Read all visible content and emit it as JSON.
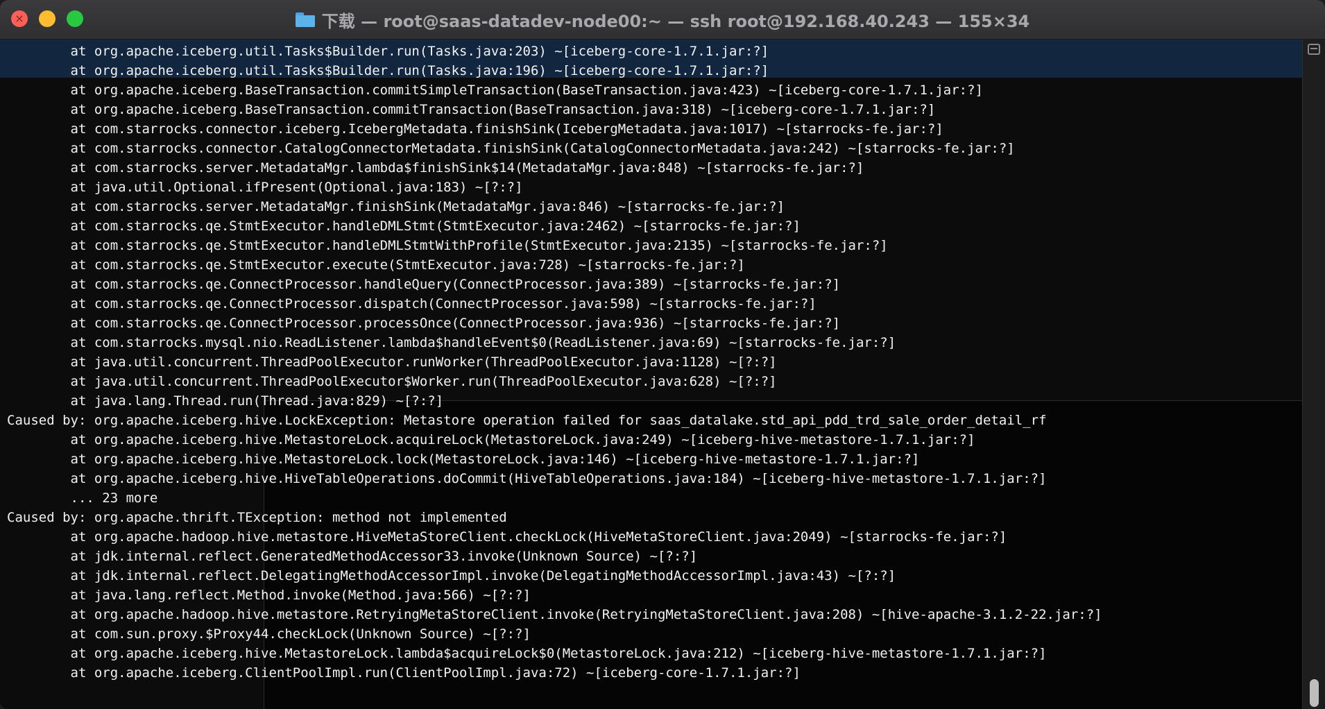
{
  "window": {
    "title": "下载 — root@saas-datadev-node00:~ — ssh root@192.168.40.243 — 155×34",
    "title_icon": "folder-icon"
  },
  "colors": {
    "close": "#fe5f57",
    "minimize": "#febc2e",
    "maximize": "#28c840",
    "terminal_bg": "#0c0c0c",
    "terminal_fg": "#f2f2f2"
  },
  "terminal": {
    "lines": [
      "        at org.apache.iceberg.util.Tasks$Builder.run(Tasks.java:203) ~[iceberg-core-1.7.1.jar:?]",
      "        at org.apache.iceberg.util.Tasks$Builder.run(Tasks.java:196) ~[iceberg-core-1.7.1.jar:?]",
      "        at org.apache.iceberg.BaseTransaction.commitSimpleTransaction(BaseTransaction.java:423) ~[iceberg-core-1.7.1.jar:?]",
      "        at org.apache.iceberg.BaseTransaction.commitTransaction(BaseTransaction.java:318) ~[iceberg-core-1.7.1.jar:?]",
      "        at com.starrocks.connector.iceberg.IcebergMetadata.finishSink(IcebergMetadata.java:1017) ~[starrocks-fe.jar:?]",
      "        at com.starrocks.connector.CatalogConnectorMetadata.finishSink(CatalogConnectorMetadata.java:242) ~[starrocks-fe.jar:?]",
      "        at com.starrocks.server.MetadataMgr.lambda$finishSink$14(MetadataMgr.java:848) ~[starrocks-fe.jar:?]",
      "        at java.util.Optional.ifPresent(Optional.java:183) ~[?:?]",
      "        at com.starrocks.server.MetadataMgr.finishSink(MetadataMgr.java:846) ~[starrocks-fe.jar:?]",
      "        at com.starrocks.qe.StmtExecutor.handleDMLStmt(StmtExecutor.java:2462) ~[starrocks-fe.jar:?]",
      "        at com.starrocks.qe.StmtExecutor.handleDMLStmtWithProfile(StmtExecutor.java:2135) ~[starrocks-fe.jar:?]",
      "        at com.starrocks.qe.StmtExecutor.execute(StmtExecutor.java:728) ~[starrocks-fe.jar:?]",
      "        at com.starrocks.qe.ConnectProcessor.handleQuery(ConnectProcessor.java:389) ~[starrocks-fe.jar:?]",
      "        at com.starrocks.qe.ConnectProcessor.dispatch(ConnectProcessor.java:598) ~[starrocks-fe.jar:?]",
      "        at com.starrocks.qe.ConnectProcessor.processOnce(ConnectProcessor.java:936) ~[starrocks-fe.jar:?]",
      "        at com.starrocks.mysql.nio.ReadListener.lambda$handleEvent$0(ReadListener.java:69) ~[starrocks-fe.jar:?]",
      "        at java.util.concurrent.ThreadPoolExecutor.runWorker(ThreadPoolExecutor.java:1128) ~[?:?]",
      "        at java.util.concurrent.ThreadPoolExecutor$Worker.run(ThreadPoolExecutor.java:628) ~[?:?]",
      "        at java.lang.Thread.run(Thread.java:829) ~[?:?]",
      "Caused by: org.apache.iceberg.hive.LockException: Metastore operation failed for saas_datalake.std_api_pdd_trd_sale_order_detail_rf",
      "        at org.apache.iceberg.hive.MetastoreLock.acquireLock(MetastoreLock.java:249) ~[iceberg-hive-metastore-1.7.1.jar:?]",
      "        at org.apache.iceberg.hive.MetastoreLock.lock(MetastoreLock.java:146) ~[iceberg-hive-metastore-1.7.1.jar:?]",
      "        at org.apache.iceberg.hive.HiveTableOperations.doCommit(HiveTableOperations.java:184) ~[iceberg-hive-metastore-1.7.1.jar:?]",
      "        ... 23 more",
      "Caused by: org.apache.thrift.TException: method not implemented",
      "        at org.apache.hadoop.hive.metastore.HiveMetaStoreClient.checkLock(HiveMetaStoreClient.java:2049) ~[starrocks-fe.jar:?]",
      "        at jdk.internal.reflect.GeneratedMethodAccessor33.invoke(Unknown Source) ~[?:?]",
      "        at jdk.internal.reflect.DelegatingMethodAccessorImpl.invoke(DelegatingMethodAccessorImpl.java:43) ~[?:?]",
      "        at java.lang.reflect.Method.invoke(Method.java:566) ~[?:?]",
      "        at org.apache.hadoop.hive.metastore.RetryingMetaStoreClient.invoke(RetryingMetaStoreClient.java:208) ~[hive-apache-3.1.2-22.jar:?]",
      "        at com.sun.proxy.$Proxy44.checkLock(Unknown Source) ~[?:?]",
      "        at org.apache.iceberg.hive.MetastoreLock.lambda$acquireLock$0(MetastoreLock.java:212) ~[iceberg-hive-metastore-1.7.1.jar:?]",
      "        at org.apache.iceberg.ClientPoolImpl.run(ClientPoolImpl.java:72) ~[iceberg-core-1.7.1.jar:?]"
    ]
  },
  "scrollbar": {
    "position_fraction": 1.0
  }
}
